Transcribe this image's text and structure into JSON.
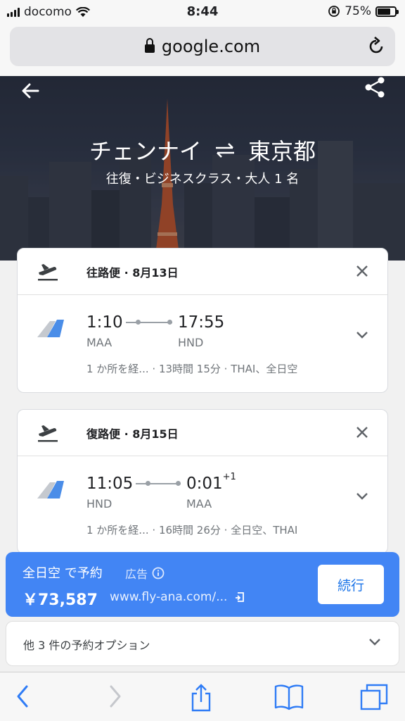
{
  "status_bar": {
    "carrier": "docomo",
    "time": "8:44",
    "battery": "75%"
  },
  "browser": {
    "url": "google.com"
  },
  "hero": {
    "from_city": "チェンナイ",
    "to_city": "東京都",
    "subtitle": "往復・ビジネスクラス・大人 1 名"
  },
  "outbound": {
    "title": "往路便 · 8月13日",
    "depart_time": "1:10",
    "arrive_time": "17:55",
    "arrive_suffix": "",
    "depart_code": "MAA",
    "arrive_code": "HND",
    "stops": "1 か所を経...",
    "details": "· 13時間 15分 · THAI、全日空"
  },
  "return": {
    "title": "復路便 · 8月15日",
    "depart_time": "11:05",
    "arrive_time": "0:01",
    "arrive_suffix": "+1",
    "depart_code": "HND",
    "arrive_code": "MAA",
    "stops": "1 か所を経...",
    "details": "· 16時間 26分 · 全日空、THAI"
  },
  "ad": {
    "title": "全日空 で予約",
    "label": "広告",
    "price": "￥73,587",
    "url": "www.fly-ana.com/...",
    "button": "続行"
  },
  "other_options": {
    "label": "他 3 件の予約オプション"
  },
  "colors": {
    "accent": "#4285f4",
    "hero_bg": "#323a4c"
  },
  "icons": [
    "back-arrow-icon",
    "share-icon",
    "takeoff-icon",
    "landing-icon",
    "close-icon",
    "chevron-down-icon",
    "info-icon",
    "external-link-icon",
    "lock-icon",
    "reload-icon"
  ]
}
